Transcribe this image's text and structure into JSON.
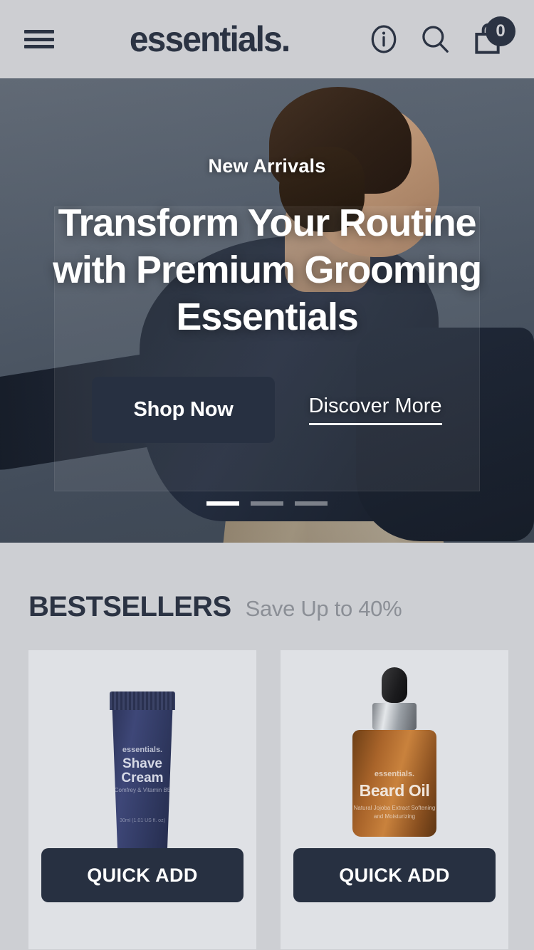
{
  "header": {
    "menu_label": "Menu",
    "logo": "essentials.",
    "info_label": "Info",
    "search_label": "Search",
    "cart_label": "Cart",
    "cart_count": "0"
  },
  "hero": {
    "eyebrow": "New Arrivals",
    "title": "Transform Your Routine with Premium Grooming Essentials",
    "primary_cta": "Shop Now",
    "secondary_cta": "Discover More",
    "slides_total": 3,
    "active_slide": 1
  },
  "bestsellers": {
    "title": "BESTSELLERS",
    "subtitle": "Save Up to 40%",
    "products": [
      {
        "brand": "essentials.",
        "name": "Shave Cream",
        "description": "Comfrey & Vitamin B5",
        "size": "30ml (1.01 US fl. oz)",
        "quick_add": "QUICK ADD"
      },
      {
        "brand": "essentials.",
        "name": "Beard Oil",
        "description": "Natural Jojoba Extract\nSoftening and Moisturizing",
        "quick_add": "QUICK ADD"
      }
    ]
  },
  "colors": {
    "brand_navy": "#2b3343",
    "button_navy": "#273041",
    "page_bg": "#cdcfd3",
    "card_bg": "#dfe1e5",
    "muted_text": "#8b8f96"
  }
}
